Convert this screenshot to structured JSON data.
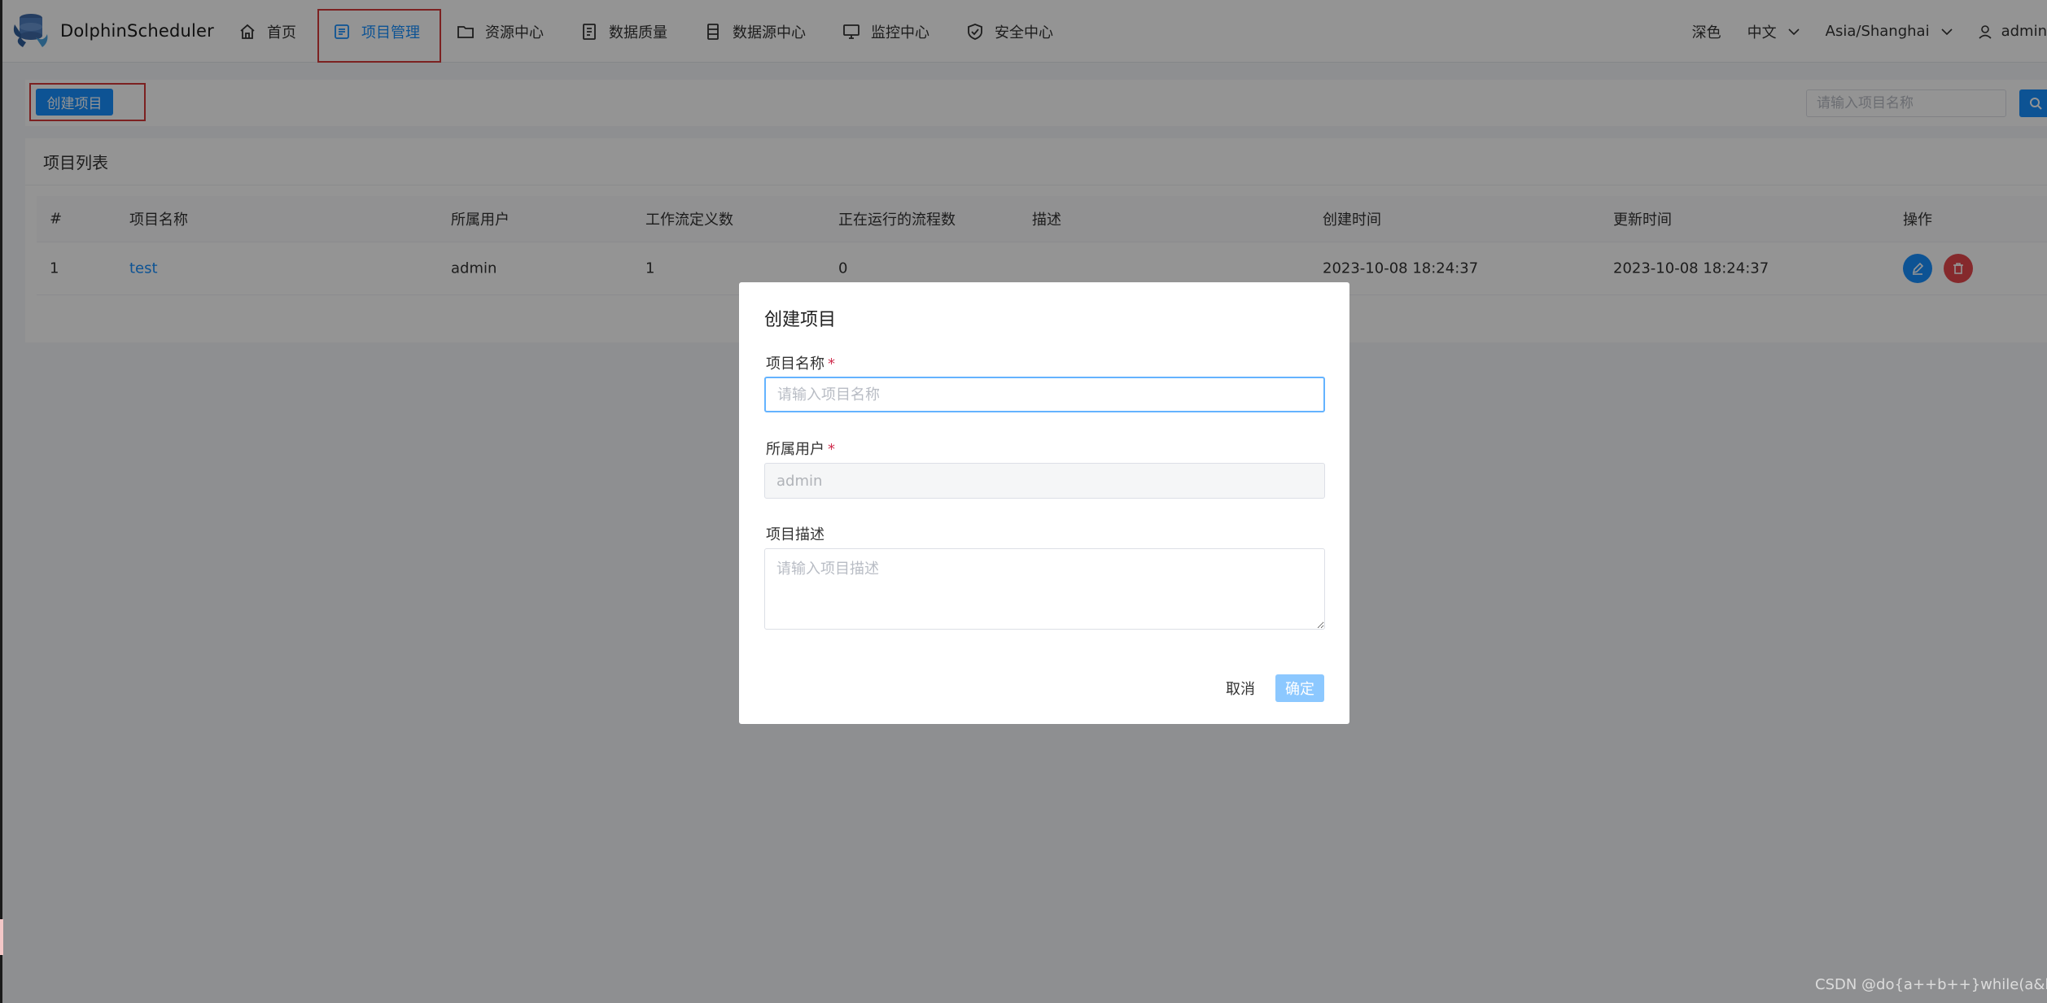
{
  "app": {
    "name": "DolphinScheduler"
  },
  "nav": {
    "items": [
      {
        "label": "首页",
        "icon": "home-icon",
        "active": false
      },
      {
        "label": "项目管理",
        "icon": "project-icon",
        "active": true
      },
      {
        "label": "资源中心",
        "icon": "folder-icon",
        "active": false
      },
      {
        "label": "数据质量",
        "icon": "data-quality-icon",
        "active": false
      },
      {
        "label": "数据源中心",
        "icon": "datasource-icon",
        "active": false
      },
      {
        "label": "监控中心",
        "icon": "monitor-icon",
        "active": false
      },
      {
        "label": "安全中心",
        "icon": "shield-icon",
        "active": false
      }
    ],
    "theme": "深色",
    "language": "中文",
    "timezone": "Asia/Shanghai",
    "user": "admin"
  },
  "toolbar": {
    "create_label": "创建项目",
    "search_placeholder": "请输入项目名称"
  },
  "card": {
    "title": "项目列表",
    "columns": [
      "#",
      "项目名称",
      "所属用户",
      "工作流定义数",
      "正在运行的流程数",
      "描述",
      "创建时间",
      "更新时间",
      "操作"
    ],
    "rows": [
      {
        "index": "1",
        "name": "test",
        "user": "admin",
        "workflow_count": "1",
        "running_count": "0",
        "description": "",
        "create_time": "2023-10-08 18:24:37",
        "update_time": "2023-10-08 18:24:37"
      }
    ]
  },
  "modal": {
    "title": "创建项目",
    "name_label": "项目名称",
    "name_placeholder": "请输入项目名称",
    "user_label": "所属用户",
    "user_value": "admin",
    "desc_label": "项目描述",
    "desc_placeholder": "请输入项目描述",
    "required_mark": "*",
    "cancel_label": "取消",
    "ok_label": "确定"
  },
  "watermark": "CSDN @do{a++b++}while(a&b)",
  "colors": {
    "primary": "#1890ff",
    "danger": "#e5484d",
    "highlight": "#d63a3a"
  }
}
